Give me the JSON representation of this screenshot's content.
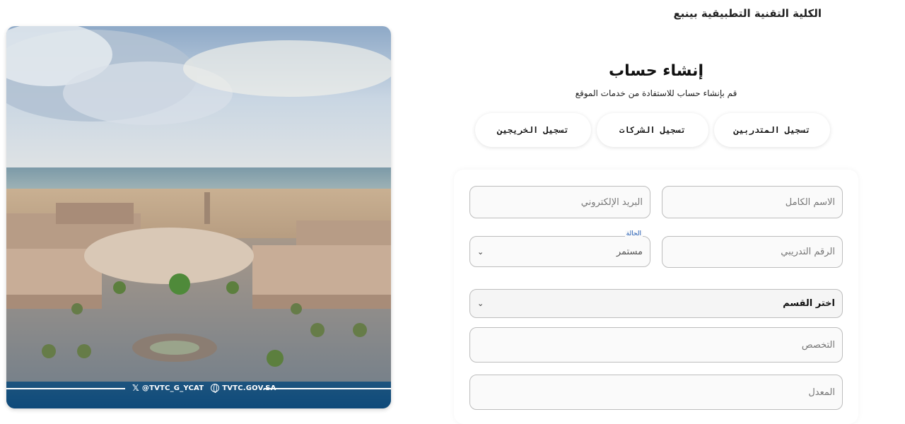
{
  "college_name": "الكلية التقنية التطبيقية بينبع",
  "page": {
    "title": "إنشاء حساب",
    "subtitle": "قم بإنشاء حساب للاستفادة من خدمات الموقع"
  },
  "tabs": [
    {
      "label": "تسجيل المتدربين"
    },
    {
      "label": "تسجيل الشركات"
    },
    {
      "label": "تسجيل الخريجين"
    }
  ],
  "form": {
    "full_name_placeholder": "الاسم الكامل",
    "email_placeholder": "البريد الإلكتروني",
    "trainee_number_placeholder": "الرقم التدريبي",
    "status_label": "الحالة",
    "status_value": "مستمر",
    "department_value": "اختر القسم",
    "specialization_placeholder": "التخصص",
    "gpa_placeholder": "المعدل"
  },
  "photo": {
    "twitter_handle": "@TVTC_G_YCAT",
    "website": "TVTC.GOV.SA"
  },
  "icons": {
    "x_logo": "x-icon",
    "globe": "globe-icon",
    "dropdown": "chevron-down-icon"
  }
}
